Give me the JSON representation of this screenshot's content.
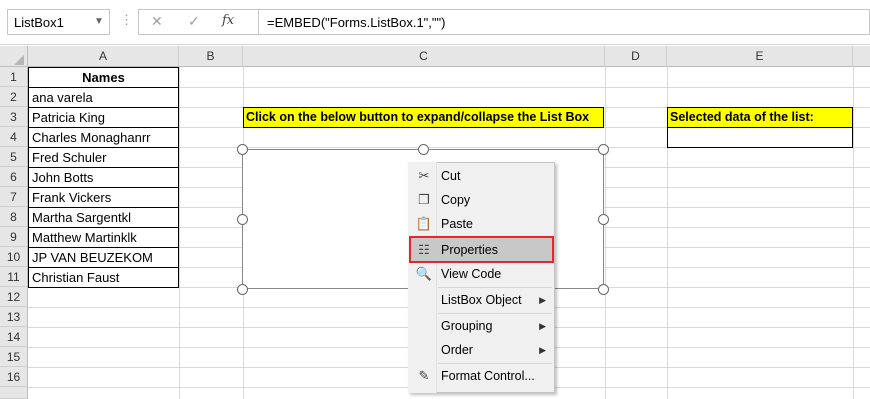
{
  "name_box": {
    "value": "ListBox1"
  },
  "formula_bar": {
    "cancel": "✕",
    "enter": "✓",
    "fx": "fx",
    "formula": "=EMBED(\"Forms.ListBox.1\",\"\")"
  },
  "columns": [
    "A",
    "B",
    "C",
    "D",
    "E"
  ],
  "rows": [
    "1",
    "2",
    "3",
    "4",
    "5",
    "6",
    "7",
    "8",
    "9",
    "10",
    "11",
    "12",
    "13",
    "14",
    "15",
    "16"
  ],
  "sheet": {
    "names_header": "Names",
    "names": [
      "ana varela",
      "Patricia King",
      "Charles Monaghanrr",
      "Fred Schuler",
      "John Botts",
      "Frank Vickers",
      "Martha Sargentkl",
      "Matthew Martinklk",
      "JP VAN BEUZEKOM",
      "Christian Faust"
    ],
    "c3": "Click on the below button to expand/collapse the List Box",
    "e3": "Selected data of the list:"
  },
  "context_menu": {
    "items": [
      {
        "label": "Cut",
        "icon": "scissors-icon"
      },
      {
        "label": "Copy",
        "icon": "copy-icon"
      },
      {
        "label": "Paste",
        "icon": "paste-icon"
      },
      {
        "label": "Properties",
        "icon": "properties-icon",
        "highlighted": true
      },
      {
        "label": "View Code",
        "icon": "view-code-icon"
      },
      {
        "label": "ListBox Object",
        "submenu": true
      },
      {
        "label": "Grouping",
        "submenu": true
      },
      {
        "label": "Order",
        "submenu": true
      },
      {
        "label": "Format Control...",
        "icon": "format-control-icon"
      }
    ]
  },
  "colors": {
    "highlight_outline": "#e5262a",
    "cell_fill": "#ffff00",
    "header_bg": "#e6e6e6"
  }
}
